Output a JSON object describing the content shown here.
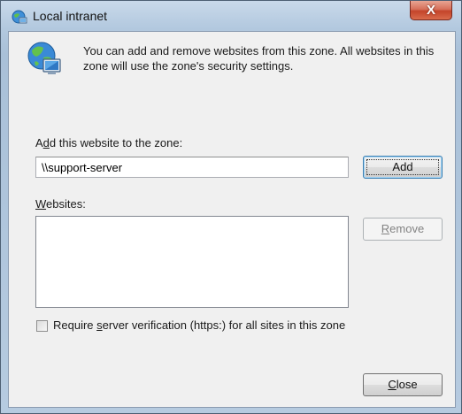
{
  "window": {
    "title": "Local intranet",
    "close_glyph": "X",
    "title_icon": "globe-icon"
  },
  "info": {
    "icon": "globe-computer-icon",
    "text": "You can add and remove websites from this zone. All websites in this zone will use the zone's security settings."
  },
  "add_section": {
    "label_prefix": "A",
    "label_access_key": "d",
    "label_suffix": "d this website to the zone:",
    "input_value": "\\\\support-server",
    "add_button": "Add"
  },
  "websites": {
    "label_access_key": "W",
    "label_suffix": "ebsites:",
    "items": [],
    "remove_prefix": "",
    "remove_access_key": "R",
    "remove_suffix": "emove"
  },
  "verification": {
    "checked": false,
    "label_prefix": "Require ",
    "label_access_key": "s",
    "label_suffix": "erver verification (https:) for all sites in this zone"
  },
  "footer": {
    "close_access_key": "C",
    "close_suffix": "lose"
  },
  "colors": {
    "close_button": "#c4442a",
    "dialog_background": "#f0f0f0",
    "title_bar": "#b3c9df"
  }
}
